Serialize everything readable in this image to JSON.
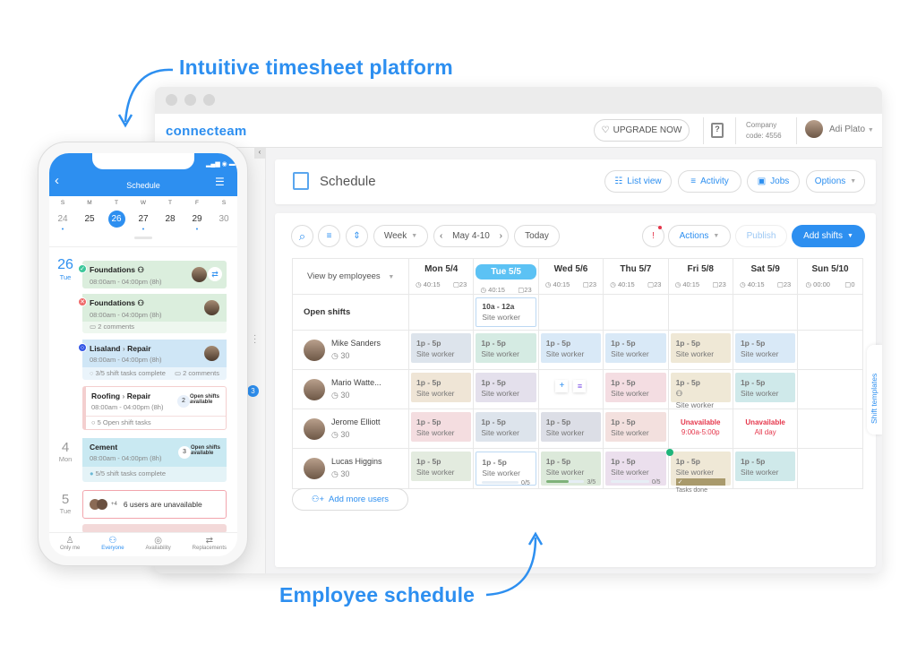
{
  "annotations": {
    "top": "Intuitive timesheet platform",
    "bottom": "Employee schedule"
  },
  "colors": {
    "accent": "#2d8ff0",
    "today": "#5cc2f4",
    "unavailable": "#e5364b"
  },
  "app": {
    "logo": "connecteam",
    "upgrade": "UPGRADE NOW",
    "company_label": "Company",
    "company_code": "code: 4556",
    "user": "Adi Plato",
    "sidebar_badge": "3"
  },
  "schedule": {
    "title": "Schedule",
    "list_view": "List view",
    "activity": "Activity",
    "jobs": "Jobs",
    "options": "Options"
  },
  "toolbar": {
    "range": "Week",
    "date": "May 4-10",
    "today": "Today",
    "actions": "Actions",
    "publish": "Publish",
    "add_shifts": "Add shifts"
  },
  "grid": {
    "view_by": "View by employees",
    "open_shifts": "Open shifts",
    "add_users": "Add more users",
    "shift_templates": "Shift templates",
    "days": [
      {
        "label": "Mon 5/4",
        "hours": "40:15",
        "count": "23"
      },
      {
        "label": "Tue 5/5",
        "hours": "40:15",
        "count": "23",
        "today": true
      },
      {
        "label": "Wed 5/6",
        "hours": "40:15",
        "count": "23"
      },
      {
        "label": "Thu 5/7",
        "hours": "40:15",
        "count": "23"
      },
      {
        "label": "Fri 5/8",
        "hours": "40:15",
        "count": "23"
      },
      {
        "label": "Sat 5/9",
        "hours": "40:15",
        "count": "23"
      },
      {
        "label": "Sun 5/10",
        "hours": "00:00",
        "count": "0"
      }
    ],
    "open_shift": {
      "day": 1,
      "time": "10a - 12a",
      "role": "Site worker"
    },
    "employees": [
      {
        "name": "Mike Sanders",
        "hours": "30",
        "cells": [
          {
            "time": "1p - 5p",
            "role": "Site worker",
            "color": "#dde4ec"
          },
          {
            "time": "1p - 5p",
            "role": "Site worker",
            "color": "#d5ebe3"
          },
          {
            "time": "1p - 5p",
            "role": "Site worker",
            "color": "#d9e9f7"
          },
          {
            "time": "1p - 5p",
            "role": "Site worker",
            "color": "#d9e9f7"
          },
          {
            "time": "1p - 5p",
            "role": "Site worker",
            "color": "#efe8d6"
          },
          {
            "time": "1p - 5p",
            "role": "Site worker",
            "color": "#d9e9f7"
          },
          null
        ]
      },
      {
        "name": "Mario Watte...",
        "hours": "30",
        "cells": [
          {
            "time": "1p - 5p",
            "role": "Site worker",
            "color": "#efe5d6"
          },
          {
            "time": "1p - 5p",
            "role": "Site worker",
            "color": "#e4e0ec"
          },
          {
            "add": "+",
            "menu": "≡"
          },
          {
            "time": "1p - 5p",
            "role": "Site worker",
            "color": "#f4dde2"
          },
          {
            "time": "1p - 5p",
            "role": "Site worker",
            "color": "#efe8d6",
            "group": true
          },
          {
            "time": "1p - 5p",
            "role": "Site worker",
            "color": "#cfe9ea"
          },
          null
        ]
      },
      {
        "name": "Jerome Elliott",
        "hours": "30",
        "cells": [
          {
            "time": "1p - 5p",
            "role": "Site worker",
            "color": "#f4dde0"
          },
          {
            "time": "1p - 5p",
            "role": "Site worker",
            "color": "#dde4ec"
          },
          {
            "time": "1p - 5p",
            "role": "Site worker",
            "color": "#dcdee6"
          },
          {
            "time": "1p - 5p",
            "role": "Site worker",
            "color": "#f3e0de"
          },
          {
            "unavailable": "Unavailable",
            "detail": "9:00a-5:00p"
          },
          {
            "unavailable": "Unavailable",
            "detail": "All day"
          },
          null
        ]
      },
      {
        "name": "Lucas Higgins",
        "hours": "30",
        "cells": [
          {
            "time": "1p - 5p",
            "role": "Site worker",
            "color": "#e3ebdf"
          },
          {
            "time": "1p - 5p",
            "role": "Site worker",
            "color": "#ffffff",
            "progress": 0,
            "tasks": "0/5"
          },
          {
            "time": "1p - 5p",
            "role": "Site worker",
            "color": "#dce9da",
            "progress": 0.6,
            "tasks": "3/5"
          },
          {
            "time": "1p - 5p",
            "role": "Site worker",
            "color": "#ebdfed",
            "progress": 0,
            "tasks": "0/5"
          },
          {
            "time": "1p - 5p",
            "role": "Site worker",
            "color": "#efe8d6",
            "done": "Tasks done"
          },
          {
            "time": "1p - 5p",
            "role": "Site worker",
            "color": "#cfe9ea"
          },
          null
        ]
      }
    ]
  },
  "phone": {
    "title": "Schedule",
    "week": [
      {
        "d": "S",
        "n": "24",
        "dot": true
      },
      {
        "d": "M",
        "n": "25"
      },
      {
        "d": "T",
        "n": "26",
        "sel": true
      },
      {
        "d": "W",
        "n": "27",
        "dot": true
      },
      {
        "d": "T",
        "n": "28"
      },
      {
        "d": "F",
        "n": "29",
        "dot": true
      },
      {
        "d": "S",
        "n": "30"
      }
    ],
    "day1": {
      "n": "26",
      "w": "Tue"
    },
    "day2": {
      "n": "4",
      "w": "Mon"
    },
    "day3": {
      "n": "5",
      "w": "Tue"
    },
    "cards": [
      {
        "title": "Foundations",
        "time": "08:00am - 04:00pm (8h)"
      },
      {
        "title": "Foundations",
        "time": "08:00am - 04:00pm (8h)",
        "comments": "2 comments"
      },
      {
        "title": "Lisaland",
        "sub": "Repair",
        "time": "08:00am - 04:00pm (8h)",
        "tasks": "3/5 shift tasks complete",
        "comments": "2 comments"
      },
      {
        "title": "Roofing",
        "sub": "Repair",
        "time": "08:00am - 04:00pm (8h)",
        "open_count": "2",
        "open_label": "Open shifts available",
        "tasks": "5 Open shift tasks"
      },
      {
        "title": "Cement",
        "time": "08:00am - 04:00pm (8h)",
        "open_count": "3",
        "open_label": "Open shifts available",
        "tasks": "5/5 shift tasks complete"
      },
      {
        "more": "+4",
        "text": "6 users are unavailable"
      }
    ],
    "tabs": [
      "Only me",
      "Everyone",
      "Availability",
      "Replacements"
    ]
  }
}
